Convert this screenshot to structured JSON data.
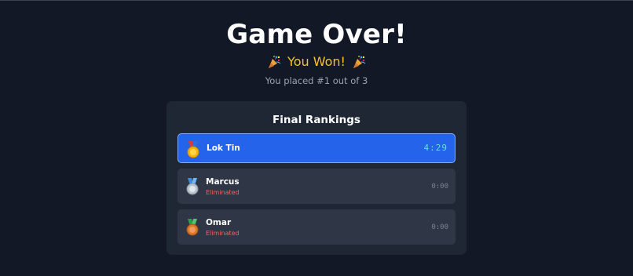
{
  "header": {
    "title": "Game Over!",
    "result": "You Won!",
    "placement": "You placed #1 out of 3"
  },
  "rankings": {
    "title": "Final Rankings",
    "players": [
      {
        "name": "Lok Tin",
        "status": "",
        "time": "4:29",
        "medal": "gold-medal-icon"
      },
      {
        "name": "Marcus",
        "status": "Eliminated",
        "time": "0:00",
        "medal": "silver-medal-icon"
      },
      {
        "name": "Omar",
        "status": "Eliminated",
        "time": "0:00",
        "medal": "bronze-medal-icon"
      }
    ]
  },
  "colors": {
    "background": "#121826",
    "panel": "#1f2735",
    "winner_row": "#2563eb",
    "gold_text": "#f5c22b",
    "eliminated_text": "#f06262",
    "timer_accent": "#5ce6c4"
  },
  "icons": [
    "party-popper-icon",
    "gold-medal-icon",
    "silver-medal-icon",
    "bronze-medal-icon"
  ]
}
